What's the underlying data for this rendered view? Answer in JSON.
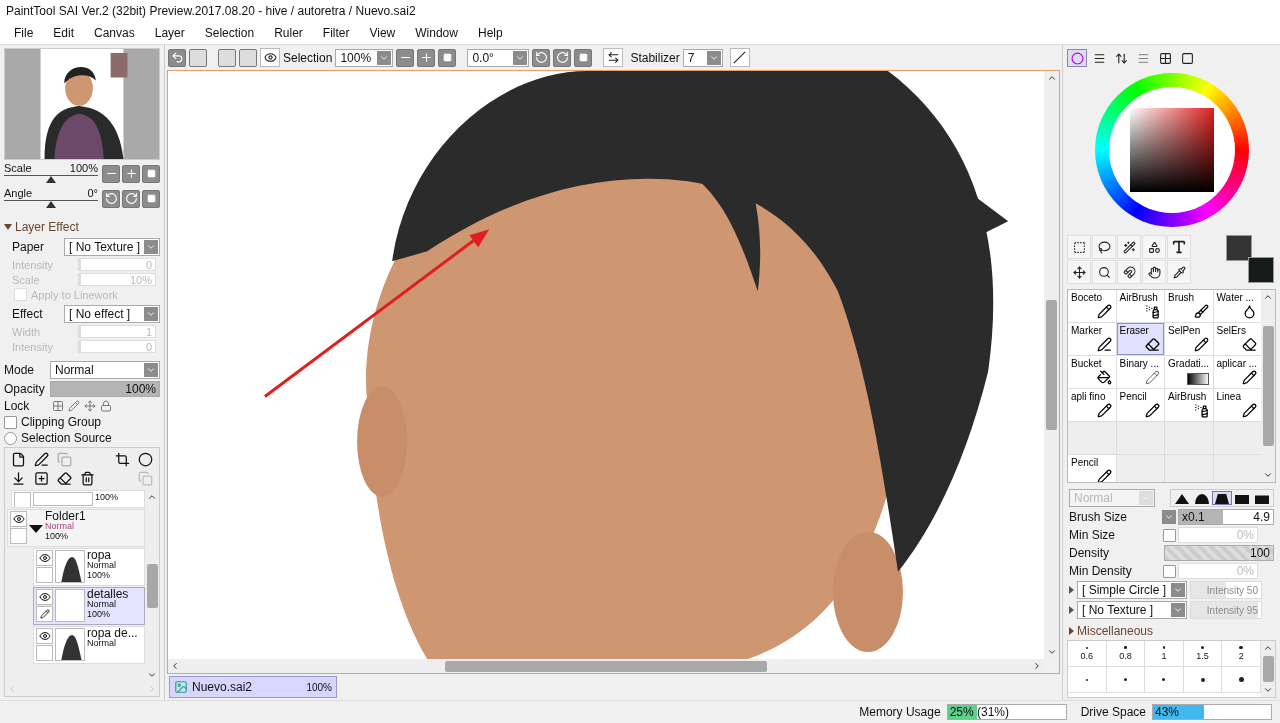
{
  "window": {
    "title": "PaintTool SAI Ver.2 (32bit) Preview.2017.08.20 - hive / autoretra / Nuevo.sai2"
  },
  "menu": [
    "File",
    "Edit",
    "Canvas",
    "Layer",
    "Selection",
    "Ruler",
    "Filter",
    "View",
    "Window",
    "Help"
  ],
  "toolbar": {
    "selection_label": "Selection",
    "zoom": "100%",
    "angle": "0.0°",
    "stabilizer_label": "Stabilizer",
    "stabilizer": "7"
  },
  "navigator": {
    "scale": {
      "label": "Scale",
      "value": "100%",
      "level": 0.5
    },
    "angle": {
      "label": "Angle",
      "value": "0°",
      "level": 0.5
    }
  },
  "layer_effect": {
    "title": "Layer Effect",
    "expanded": true,
    "fields": [
      {
        "kind": "select",
        "label": "Paper",
        "value": "[ No Texture ]",
        "disabled": false
      },
      {
        "kind": "slider",
        "label": "Intensity",
        "value": "0",
        "level": 0,
        "disabled": true
      },
      {
        "kind": "slider",
        "label": "Scale",
        "value": "10%",
        "level": 0.02,
        "disabled": true
      },
      {
        "kind": "checkbox",
        "label": "Apply to Linework",
        "checked": false,
        "disabled": true
      },
      {
        "kind": "select",
        "label": "Effect",
        "value": "[ No effect ]",
        "disabled": false
      },
      {
        "kind": "slider",
        "label": "Width",
        "value": "1",
        "level": 0.03,
        "disabled": true
      },
      {
        "kind": "slider",
        "label": "Intensity",
        "value": "0",
        "level": 0,
        "disabled": true
      }
    ]
  },
  "mode": {
    "label": "Mode",
    "value": "Normal"
  },
  "opacity": {
    "label": "Opacity",
    "value": "100%",
    "level": 1
  },
  "lock": {
    "label": "Lock"
  },
  "clipping_group": {
    "label": "Clipping Group",
    "checked": false
  },
  "selection_source": {
    "label": "Selection Source",
    "checked": false
  },
  "layers": [
    {
      "kind": "layer",
      "opacity": "100%",
      "selected": false
    },
    {
      "kind": "folder",
      "name": "Folder1",
      "mode": "Normal",
      "opacity": "100%",
      "visible": true,
      "expanded": true,
      "selected": false,
      "children": [
        {
          "kind": "layer",
          "name": "ropa",
          "mode": "Normal",
          "opacity": "100%",
          "visible": true,
          "selected": false
        },
        {
          "kind": "layer",
          "name": "detalles",
          "mode": "Normal",
          "opacity": "100%",
          "visible": true,
          "selected": true
        },
        {
          "kind": "layer",
          "name": "ropa de...",
          "mode": "Normal",
          "visible": true,
          "selected": false
        }
      ]
    }
  ],
  "document_tab": {
    "name": "Nuevo.sai2",
    "zoom": "100%",
    "selected": true
  },
  "color_panel_tabs": [
    {
      "selected": true
    },
    {
      "selected": false
    },
    {
      "selected": false
    },
    {
      "selected": false
    },
    {
      "selected": false
    },
    {
      "selected": false
    }
  ],
  "brushes": [
    {
      "name": "Boceto",
      "kind": "pencil",
      "selected": false
    },
    {
      "name": "AirBrush",
      "kind": "airbrush",
      "selected": false
    },
    {
      "name": "Brush",
      "kind": "brush",
      "selected": false
    },
    {
      "name": "Water ...",
      "kind": "water",
      "selected": false
    },
    {
      "name": "Marker",
      "kind": "marker",
      "selected": false
    },
    {
      "name": "Eraser",
      "kind": "eraser",
      "selected": true
    },
    {
      "name": "SelPen",
      "kind": "selpen",
      "selected": false
    },
    {
      "name": "SelErs",
      "kind": "selers",
      "selected": false
    },
    {
      "name": "Bucket",
      "kind": "bucket",
      "selected": false
    },
    {
      "name": "Binary ...",
      "kind": "binary",
      "selected": false
    },
    {
      "name": "Gradati...",
      "kind": "gradient",
      "selected": false
    },
    {
      "name": "aplicar ...",
      "kind": "pencil",
      "selected": false
    },
    {
      "name": "apli fino",
      "kind": "pencil",
      "selected": false
    },
    {
      "name": "Pencil",
      "kind": "pencil",
      "selected": false
    },
    {
      "name": "AirBrush",
      "kind": "airbrush",
      "selected": false
    },
    {
      "name": "Linea",
      "kind": "pencil",
      "selected": false
    },
    {
      "kind": "empty"
    },
    {
      "kind": "empty"
    },
    {
      "kind": "empty"
    },
    {
      "kind": "empty"
    },
    {
      "name": "Pencil",
      "kind": "pencil",
      "selected": false
    },
    {
      "kind": "empty"
    },
    {
      "kind": "empty"
    },
    {
      "kind": "empty"
    }
  ],
  "brush_settings": {
    "blend": "Normal",
    "shapes": [
      {
        "selected": false
      },
      {
        "selected": false
      },
      {
        "selected": true
      },
      {
        "selected": false
      },
      {
        "selected": false
      }
    ],
    "brush_size": {
      "label": "Brush Size",
      "multiplier": "x0.1",
      "value": "4.9",
      "level": 0.47
    },
    "min_size": {
      "label": "Min Size",
      "value": "0%",
      "checked": false,
      "disabled": true
    },
    "density": {
      "label": "Density",
      "value": "100",
      "level": 1
    },
    "min_density": {
      "label": "Min Density",
      "value": "0%",
      "checked": false,
      "disabled": true
    },
    "shape": {
      "value": "[ Simple Circle ]",
      "intensity": "Intensity 50",
      "level": 0.5
    },
    "texture": {
      "value": "[ No Texture ]",
      "intensity": "Intensity 95",
      "level": 0.95
    },
    "misc_label": "Miscellaneous",
    "sizes": [
      "0.6",
      "0.8",
      "1",
      "1.5",
      "2"
    ]
  },
  "status": {
    "memory": {
      "label": "Memory Usage",
      "value": "25% (31%)",
      "level": 0.25
    },
    "drive": {
      "label": "Drive Space",
      "value": "43%",
      "level": 0.43
    }
  }
}
